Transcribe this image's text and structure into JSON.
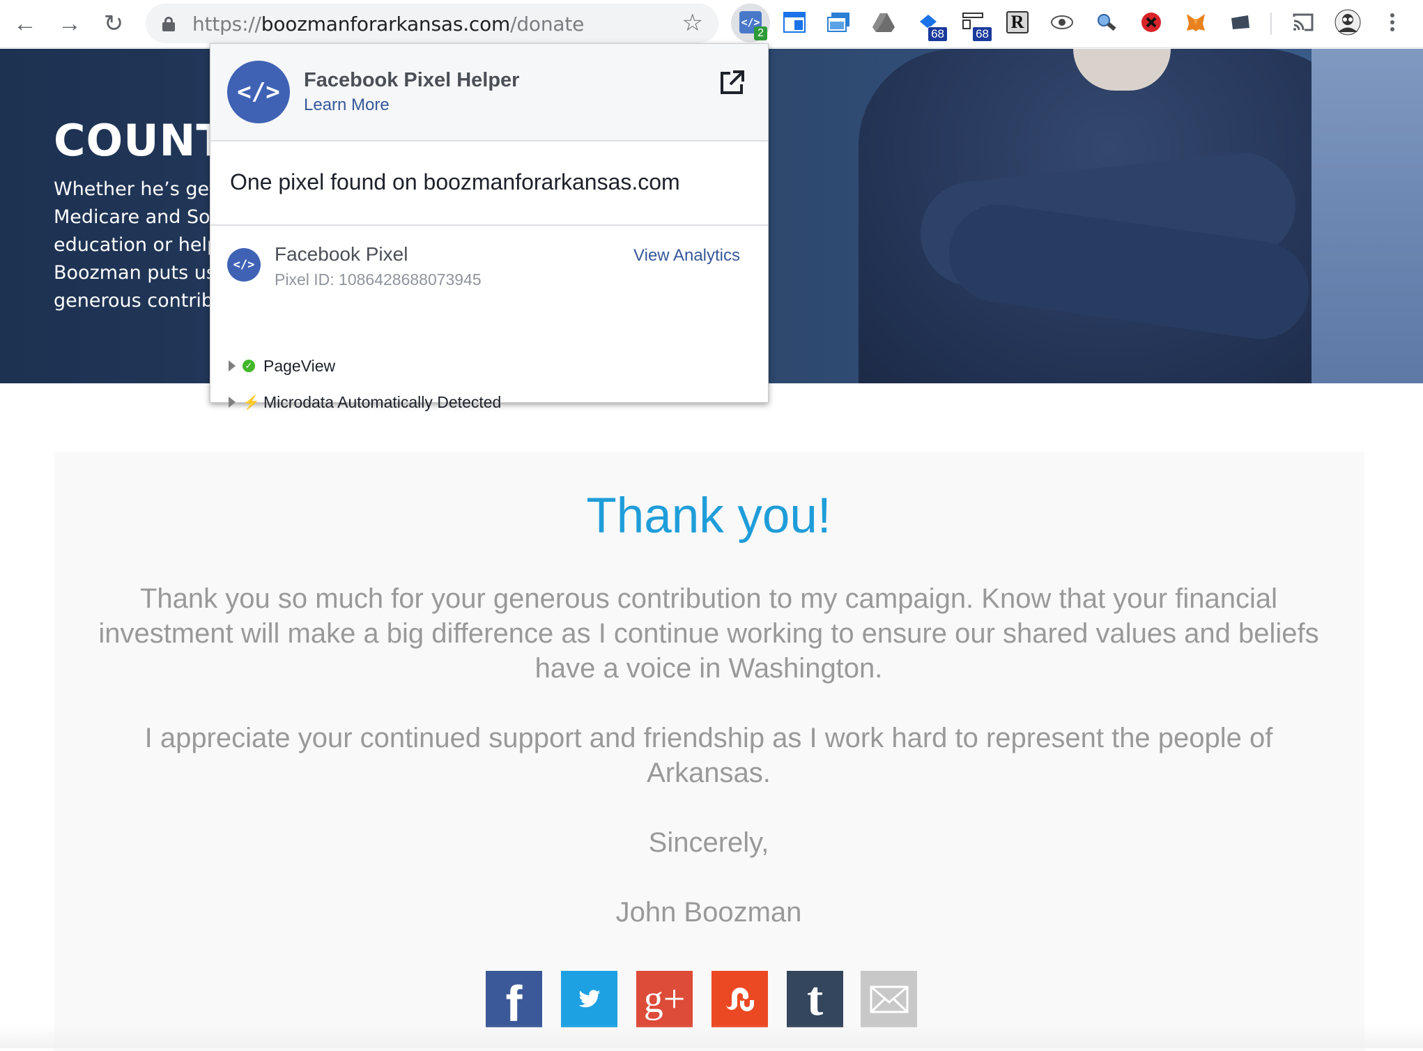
{
  "browser": {
    "url_prefix": "https://",
    "url_host": "boozmanforarkansas.com",
    "url_path": "/donate",
    "extensions": [
      {
        "name": "facebook-pixel-helper-icon",
        "badge": "2"
      },
      {
        "name": "window-extension-icon"
      },
      {
        "name": "screenshot-extension-icon"
      },
      {
        "name": "google-drive-icon"
      },
      {
        "name": "extension-badge-icon",
        "badge": "68"
      },
      {
        "name": "extension-badge-icon",
        "badge": "68"
      },
      {
        "name": "r-extension-icon",
        "glyph": "R"
      },
      {
        "name": "eye-icon"
      },
      {
        "name": "inspector-icon"
      },
      {
        "name": "blocker-icon"
      },
      {
        "name": "metamask-fox-icon"
      },
      {
        "name": "folder-icon"
      },
      {
        "name": "cast-icon"
      },
      {
        "name": "profile-avatar-icon"
      },
      {
        "name": "menu-kebab-icon"
      }
    ]
  },
  "hero": {
    "title": "COUNT",
    "lines": [
      "Whether he’s gett",
      "Medicare and Soc",
      "education or help",
      "Boozman puts us",
      "generous contrib"
    ]
  },
  "popup": {
    "title": "Facebook Pixel Helper",
    "learn_more": "Learn More",
    "found_text": "One pixel found on boozmanforarkansas.com",
    "pixel_name": "Facebook Pixel",
    "pixel_id": "Pixel ID: 1086428688073945",
    "view_analytics": "View Analytics",
    "events": [
      {
        "label": "PageView",
        "status": "success"
      },
      {
        "label": "Microdata Automatically Detected",
        "status": "auto"
      }
    ]
  },
  "content": {
    "heading": "Thank you!",
    "para1": "Thank you so much for your generous contribution to my campaign. Know that your financial investment will make a big difference as I continue working to ensure our shared values and beliefs have a voice in Washington.",
    "para2": "I appreciate your continued support and friendship as I work hard to represent the people of Arkansas.",
    "closing": "Sincerely,",
    "signature": "John Boozman"
  },
  "share": {
    "facebook": "f",
    "googleplus": "g+",
    "tumblr": "t"
  },
  "colors": {
    "accent_blue": "#1f9dd9",
    "facebook": "#3b5998",
    "twitter": "#1da1e2",
    "googleplus": "#dd4b39",
    "stumbleupon": "#eb4924",
    "tumblr": "#34465d",
    "email": "#c8c8c8"
  }
}
